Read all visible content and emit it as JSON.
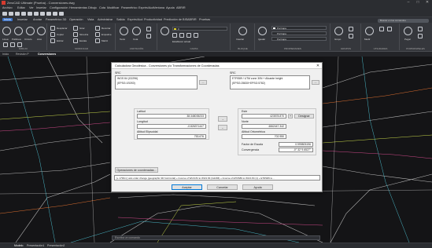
{
  "window": {
    "title": "ZeroCAD Ultimate (Prueba) - Conversiones.dwg",
    "minimize": "–",
    "maximize": "□",
    "close": "✕"
  },
  "menu": [
    "Archivo",
    "Editar",
    "Ver",
    "Insertar",
    "Configuración",
    "Herramientas",
    "Dibujo",
    "Cota",
    "Modificar",
    "Paramétrico",
    "Exprés/Acd",
    "Ventana",
    "Ayuda",
    "ABRIR"
  ],
  "ribbon_tabs": [
    "Inicio",
    "Insertar",
    "Anotar",
    "Paramétrico 3D",
    "Operación",
    "Vista",
    "Administrar",
    "Salida",
    "Exprés/Acd",
    "Productividad",
    "Predicción de BIS",
    "ABRIR",
    "Pruebas"
  ],
  "active_ribbon_tab": "Inicio",
  "search_placeholder": "Buscar en los comandos",
  "ribbon_groups": {
    "draw": "DIBUJO",
    "modify": "MODIFICAR",
    "annotation": "ANOTACIÓN",
    "layers": "CAPAS",
    "block": "BLOQUE",
    "properties": "PROPIEDADES",
    "groups": "GRUPOS",
    "utilities": "UTILIDADES",
    "clipboard": "PORTAPAPELES"
  },
  "ribbon_labels": {
    "line": "Línea",
    "polyline": "Polilínea",
    "circle": "Círculo",
    "arc": "Arco",
    "move": "Desplazar",
    "copy": "Copiar",
    "rotate": "Girar",
    "mirror": "Simetría",
    "stretch": "Estirar",
    "trim": "Recortar",
    "extend": "Alargar",
    "fillet": "Empalme",
    "scale": "Escala",
    "array": "Matriz",
    "text": "Texto",
    "dimension": "Cota",
    "insert": "Insertar",
    "match_properties": "Igualar",
    "layer_current": "Establecer actual",
    "layer_name": "0",
    "bylayer1": "PorCapa",
    "bylayer2": "PorCapa",
    "bylayer3": "PorCapa",
    "group": "Grupo",
    "measure": "Medir",
    "paste": "Pegar"
  },
  "doc_tabs": [
    "Inicio",
    "Revisión P",
    "Conversiones"
  ],
  "active_doc_tab": "Conversiones",
  "dialog": {
    "title": "Calculadora Geodésica - Conversiones y/o Transformaciones de Coordenadas",
    "close": "✕",
    "src_left_label": "SRC",
    "src_left_items": [
      "WGS 84 (G2296)",
      "(EPSG:1S0S0)"
    ],
    "src_right_label": "SRC",
    "src_right_items": [
      "ETRS89 / UTM zone 30N + Alicante height",
      "(EPSG:25830+EPSG:5782)"
    ],
    "browse_left": "...",
    "browse_right": "...",
    "latitude_label": "Latitud",
    "latitude_value": "38.348035233",
    "longitude_label": "Longitud",
    "longitude_value": "-0.826371447",
    "ellip_height_label": "Altitud Elipsoidal",
    "ellip_height_value": "753.676",
    "easting_label": "Este",
    "easting_value": "423578.870",
    "northing_label": "Norte",
    "northing_value": "4662447.342",
    "ortho_height_label": "Altitud Ortométrica",
    "ortho_height_value": "702.950",
    "scale_factor_label": "Factor de Escala",
    "scale_factor_value": "0.999805196",
    "convergence_label": "Convergencia",
    "convergence_value": "-0° 32' 9.6527\"",
    "arrow_right": "→",
    "arrow_left": "←",
    "pick_label": "Designar",
    "pick_x": "+",
    "operations_button": "Operaciones de coordenadas...",
    "pipeline": "[+ 1793m ] axis order change (geographic 3D horizontal) + Inverse of WGS 84 to WGS 84 (G2296) + Inverse of ETRS89 to WGS 84 (1) + ETRS89 to...",
    "accept": "Aceptar",
    "cancel": "Cancelar",
    "help": "Ayuda"
  },
  "command_line": "Escriba un comando",
  "status": {
    "model": "Modelo",
    "layout1": "Presentación1",
    "layout2": "Presentación2"
  }
}
